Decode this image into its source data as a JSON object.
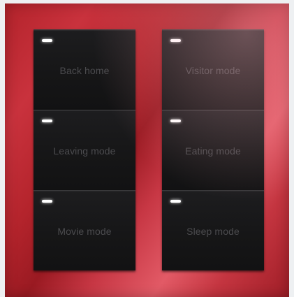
{
  "switch_panel": {
    "left_column": [
      {
        "label": "Back home",
        "indicator": "led-indicator"
      },
      {
        "label": "Leaving mode",
        "indicator": "led-indicator"
      },
      {
        "label": "Movie mode",
        "indicator": "led-indicator"
      }
    ],
    "right_column": [
      {
        "label": "Visitor mode",
        "indicator": "led-indicator"
      },
      {
        "label": "Eating mode",
        "indicator": "led-indicator"
      },
      {
        "label": "Sleep mode",
        "indicator": "led-indicator"
      }
    ]
  },
  "colors": {
    "panel": "#b3232b",
    "key": "#161617",
    "label": "#4b4b4e",
    "led": "#ffffff"
  }
}
